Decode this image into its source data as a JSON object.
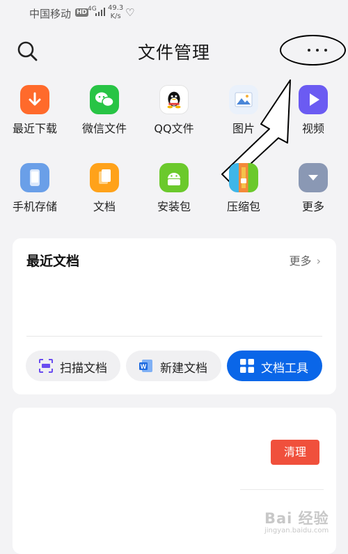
{
  "status_bar": {
    "carrier": "中国移动",
    "hd": "HD",
    "network": "4G",
    "speed_value": "49.3",
    "speed_unit": "K/s"
  },
  "header": {
    "title": "文件管理"
  },
  "categories": [
    {
      "label": "最近下载",
      "icon": "download-icon",
      "color": "#ff6a2b"
    },
    {
      "label": "微信文件",
      "icon": "wechat-icon",
      "color": "#28c445"
    },
    {
      "label": "QQ文件",
      "icon": "qq-icon",
      "color": "#ffffff"
    },
    {
      "label": "图片",
      "icon": "picture-icon",
      "color": "#eaf1fb"
    },
    {
      "label": "视频",
      "icon": "video-icon",
      "color": "#6b5bf2"
    },
    {
      "label": "手机存储",
      "icon": "phone-storage-icon",
      "color": "#6a9fe8"
    },
    {
      "label": "文档",
      "icon": "document-icon",
      "color": "#ffa21a"
    },
    {
      "label": "安装包",
      "icon": "android-package-icon",
      "color": "#6bc92c"
    },
    {
      "label": "压缩包",
      "icon": "zip-icon",
      "color": "#f48a3a"
    },
    {
      "label": "更多",
      "icon": "more-categories-icon",
      "color": "#8a98b4"
    }
  ],
  "recent_docs": {
    "title": "最近文档",
    "more_label": "更多",
    "actions": [
      {
        "label": "扫描文档",
        "icon": "scan-icon"
      },
      {
        "label": "新建文档",
        "icon": "word-doc-icon"
      },
      {
        "label": "文档工具",
        "icon": "grid-tools-icon"
      }
    ]
  },
  "cleanup": {
    "button_label": "清理"
  },
  "watermark": {
    "main": "Bai 经验",
    "sub": "jingyan.baidu.com"
  },
  "colors": {
    "accent_blue": "#0a66e8",
    "clean_red": "#f0503c",
    "background": "#f3f3f5"
  }
}
